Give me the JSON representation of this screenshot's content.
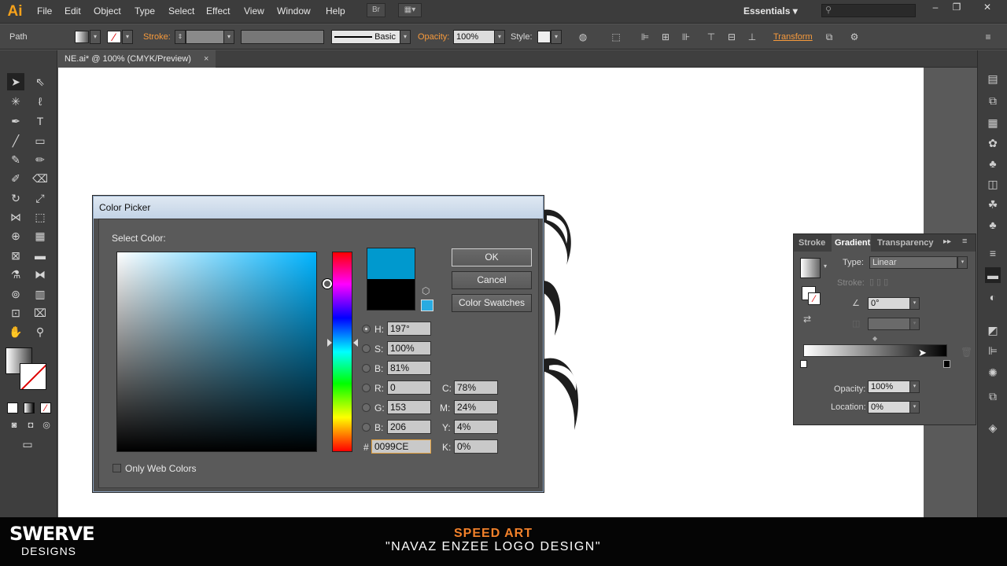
{
  "app": {
    "logo": "Ai",
    "menus": [
      "File",
      "Edit",
      "Object",
      "Type",
      "Select",
      "Effect",
      "View",
      "Window",
      "Help"
    ],
    "workspace": "Essentials",
    "workspace_arrow": "▾",
    "bridge_label": "Br"
  },
  "control_bar": {
    "selection_type": "Path",
    "stroke_label": "Stroke:",
    "brush_label": "Basic",
    "opacity_label": "Opacity:",
    "opacity_value": "100%",
    "style_label": "Style:",
    "transform_label": "Transform"
  },
  "document": {
    "tab_title": "NE.ai* @ 100% (CMYK/Preview)",
    "close": "×"
  },
  "color_picker": {
    "title": "Color Picker",
    "select_color_label": "Select Color:",
    "ok": "OK",
    "cancel": "Cancel",
    "swatches": "Color Swatches",
    "new_color": "#0099CE",
    "old_color": "#000000",
    "hsb": [
      {
        "label": "H:",
        "value": "197°"
      },
      {
        "label": "S:",
        "value": "100%"
      },
      {
        "label": "B:",
        "value": "81%"
      }
    ],
    "rgb": [
      {
        "label": "R:",
        "value": "0"
      },
      {
        "label": "G:",
        "value": "153"
      },
      {
        "label": "B:",
        "value": "206"
      }
    ],
    "cmyk": [
      {
        "label": "C:",
        "value": "78%"
      },
      {
        "label": "M:",
        "value": "24%"
      },
      {
        "label": "Y:",
        "value": "4%"
      },
      {
        "label": "K:",
        "value": "0%"
      }
    ],
    "hex_label": "#",
    "hex_value": "0099CE",
    "only_web": "Only Web Colors"
  },
  "gradient_panel": {
    "tabs": [
      "Stroke",
      "Gradient",
      "Transparency"
    ],
    "type_label": "Type:",
    "type_value": "Linear",
    "stroke_label": "Stroke:",
    "angle_value": "0°",
    "opacity_label": "Opacity:",
    "opacity_value": "100%",
    "location_label": "Location:",
    "location_value": "0%"
  },
  "footer": {
    "brand": "SWERVE",
    "brand_sub": "DESIGNS",
    "title": "SPEED ART",
    "subtitle": "\"NAVAZ ENZEE LOGO DESIGN\""
  }
}
